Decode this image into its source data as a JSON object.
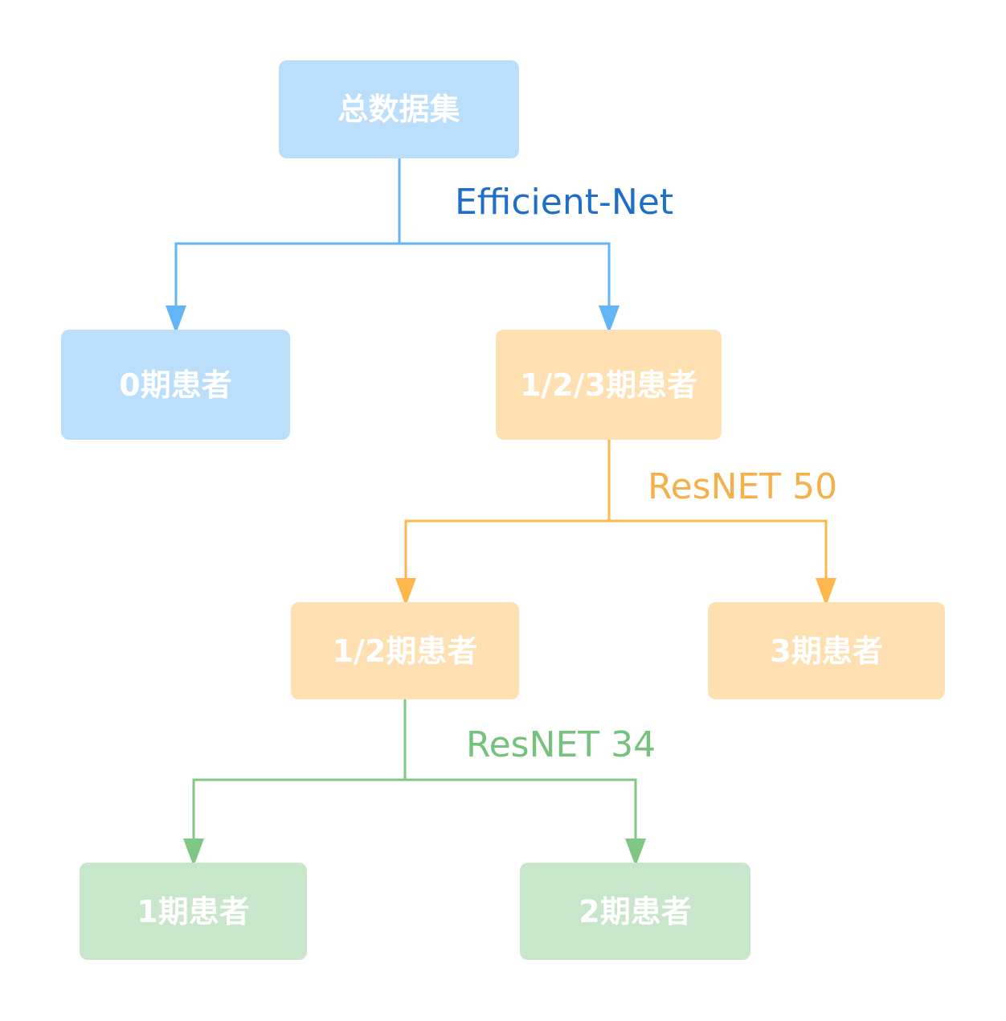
{
  "nodes": {
    "root": "总数据集",
    "stage0": "0期患者",
    "stage123": "1/2/3期患者",
    "stage12": "1/2期患者",
    "stage3": "3期患者",
    "stage1": "1期患者",
    "stage2": "2期患者"
  },
  "edge_labels": {
    "split1": "Efficient-Net",
    "split2": "ResNET 50",
    "split3": "ResNET 34"
  },
  "colors": {
    "blue_box": "#bbdefb",
    "blue_line": "#64b5f6",
    "blue_label": "#1f6fc8",
    "orange_box": "#ffe0b2",
    "orange_line": "#ffb74d",
    "orange_label": "#f5b04a",
    "green_box": "#c8e6c9",
    "green_line": "#81c784",
    "green_label": "#74c27c"
  }
}
